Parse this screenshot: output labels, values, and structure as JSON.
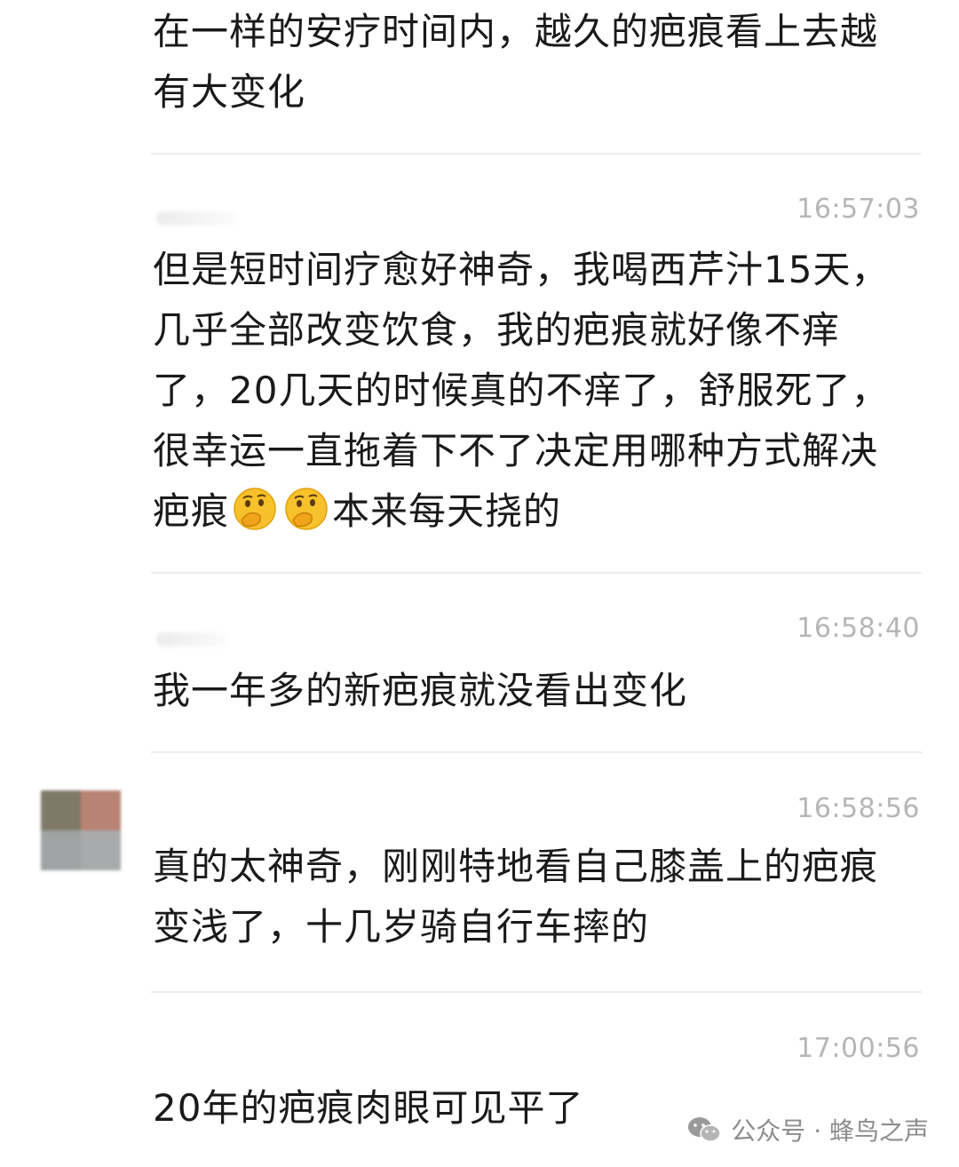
{
  "comments": [
    {
      "text": "在一样的安疗时间内，越久的疤痕看上去越有大变化"
    },
    {
      "timestamp": "16:57:03",
      "text_before_emoji": "但是短时间疗愈好神奇，我喝西芹汁15天，几乎全部改变饮食，我的疤痕就好像不痒了，20几天的时候真的不痒了，舒服死了，很幸运一直拖着下不了决定用哪种方式解决疤痕",
      "emoji": "thinking-face-emoji",
      "text_after_emoji": "本来每天挠的"
    },
    {
      "timestamp": "16:58:40",
      "text": "我一年多的新疤痕就没看出变化"
    },
    {
      "timestamp": "16:58:56",
      "text": "真的太神奇，刚刚特地看自己膝盖上的疤痕变浅了，十几岁骑自行车摔的"
    },
    {
      "timestamp": "17:00:56",
      "text": "20年的疤痕肉眼可见平了"
    }
  ],
  "watermark": {
    "icon": "wechat-icon",
    "label": "公众号 · 蜂鸟之声"
  },
  "colors": {
    "text": "#1a1a1a",
    "timestamp": "#b6b6b6",
    "divider": "#ececec",
    "watermark": "#8c8c8c"
  }
}
